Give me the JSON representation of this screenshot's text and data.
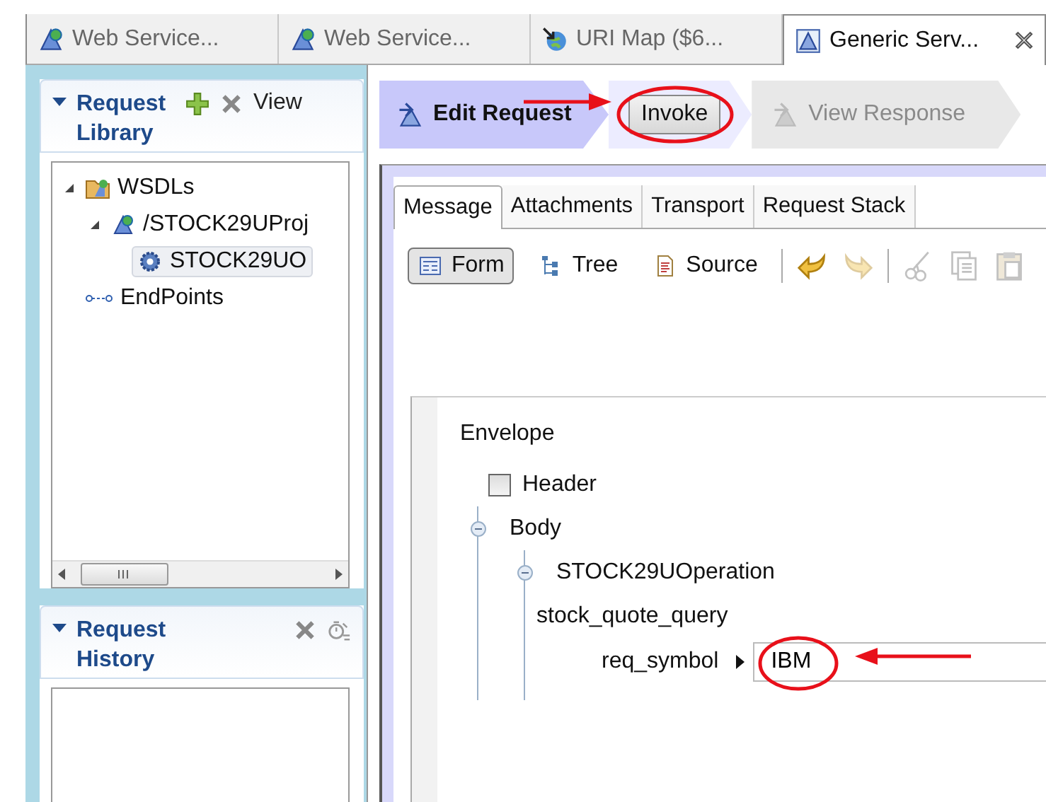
{
  "editor_tabs": [
    {
      "label": "Web Service...",
      "kind": "wsdl",
      "selected": false,
      "closable": false
    },
    {
      "label": "Web Service...",
      "kind": "wsdl",
      "selected": false,
      "closable": false
    },
    {
      "label": "URI Map ($6...",
      "kind": "globe",
      "selected": false,
      "closable": false
    },
    {
      "label": "Generic Serv...",
      "kind": "generic",
      "selected": true,
      "closable": true
    }
  ],
  "request_library": {
    "title": "Request Library",
    "expanded": true,
    "action": "View",
    "tree": [
      {
        "label": "WSDLs",
        "kind": "folder",
        "expanded": true,
        "selected": false,
        "children": [
          {
            "label": "/STOCK29UProj",
            "kind": "wsdl",
            "expanded": true,
            "selected": false,
            "children": [
              {
                "label": "STOCK29UO",
                "kind": "operation",
                "selected": true
              }
            ]
          }
        ]
      },
      {
        "label": "EndPoints",
        "kind": "endpoints",
        "selected": false
      }
    ]
  },
  "request_history": {
    "title": "Request History",
    "expanded": true
  },
  "steps": [
    {
      "label": "Edit Request",
      "selected": true,
      "disabled": false
    },
    {
      "label": "Invoke",
      "selected": false,
      "disabled": false
    },
    {
      "label": "View Response",
      "selected": false,
      "disabled": true
    }
  ],
  "message_tabs": [
    {
      "label": "Message",
      "selected": true
    },
    {
      "label": "Attachments",
      "selected": false
    },
    {
      "label": "Transport",
      "selected": false
    },
    {
      "label": "Request Stack",
      "selected": false
    }
  ],
  "view_modes": [
    {
      "label": "Form",
      "kind": "form",
      "selected": true
    },
    {
      "label": "Tree",
      "kind": "tree",
      "selected": false
    },
    {
      "label": "Source",
      "kind": "source",
      "selected": false
    }
  ],
  "edit_tools": [
    {
      "kind": "undo",
      "disabled": false
    },
    {
      "kind": "redo",
      "disabled": true
    },
    {
      "kind": "separator"
    },
    {
      "kind": "cut",
      "disabled": true
    },
    {
      "kind": "copy",
      "disabled": true
    },
    {
      "kind": "paste",
      "disabled": true
    }
  ],
  "form": {
    "envelope": "Envelope",
    "header": {
      "label": "Header",
      "checked": false
    },
    "body": {
      "label": "Body",
      "expanded": true
    },
    "operation": {
      "label": "STOCK29UOperation",
      "expanded": true
    },
    "query": "stock_quote_query",
    "field": {
      "label": "req_symbol",
      "value": "IBM"
    }
  }
}
